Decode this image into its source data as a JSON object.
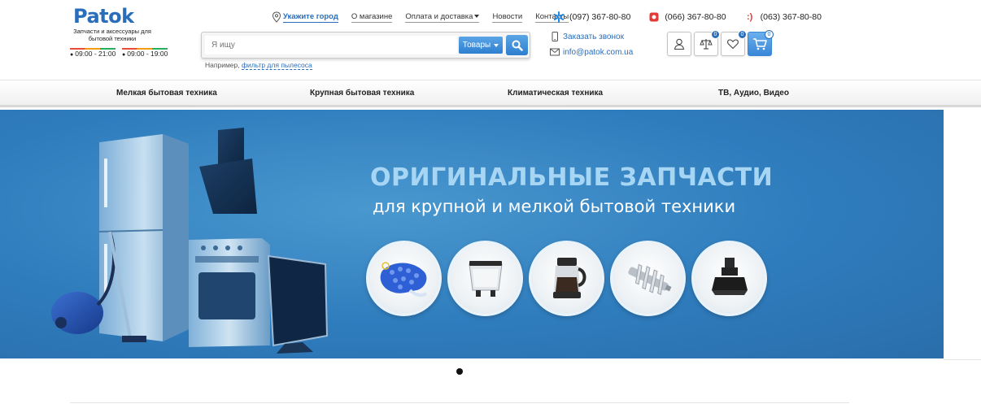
{
  "logo": {
    "text": "Patok"
  },
  "tagline": "Запчасти и аксессуары для бытовой техники",
  "hours": [
    {
      "dot": "●",
      "text": "09:00 - 21:00"
    },
    {
      "dot": "●",
      "text": "09:00 - 19:00"
    }
  ],
  "topnav": {
    "city": "Укажите город",
    "items": [
      "О магазине",
      "Оплата и доставка",
      "Новости",
      "Контакты"
    ]
  },
  "phones": [
    {
      "operator_icon": "kyivstar-icon",
      "number": "(097) 367-80-80",
      "color": "#1e88e5"
    },
    {
      "operator_icon": "vodafone-icon",
      "number": "(066) 367-80-80",
      "color": "#e53935"
    },
    {
      "operator_icon": "lifecell-icon",
      "number": "(063) 367-80-80",
      "color": "#e53935"
    }
  ],
  "search": {
    "placeholder": "Я ищу",
    "category": "Товары",
    "hint_prefix": "Например,",
    "hint_link": "фильтр для пылесоса"
  },
  "contacts": {
    "callback": "Заказать звонок",
    "email": "info@patok.com.ua"
  },
  "icon_buttons": {
    "compare_count": "0",
    "wishlist_count": "0",
    "cart_count": "0"
  },
  "categories": [
    "Мелкая бытовая техника",
    "Крупная бытовая техника",
    "Климатическая техника",
    "ТВ, Аудио, Видео"
  ],
  "banner": {
    "title": "ОРИГИНАЛЬНЫЕ ЗАПЧАСТИ",
    "subtitle": "для крупной и мелкой бытовой техники",
    "products": [
      "vacuum-filter-icon",
      "bread-maker-pan-icon",
      "coffee-jug-icon",
      "grinder-auger-icon",
      "blender-gearbox-icon"
    ]
  },
  "colors": {
    "accent": "#2a6ebb",
    "banner": "#2f7cbd",
    "title_light": "#a7d6f5"
  }
}
